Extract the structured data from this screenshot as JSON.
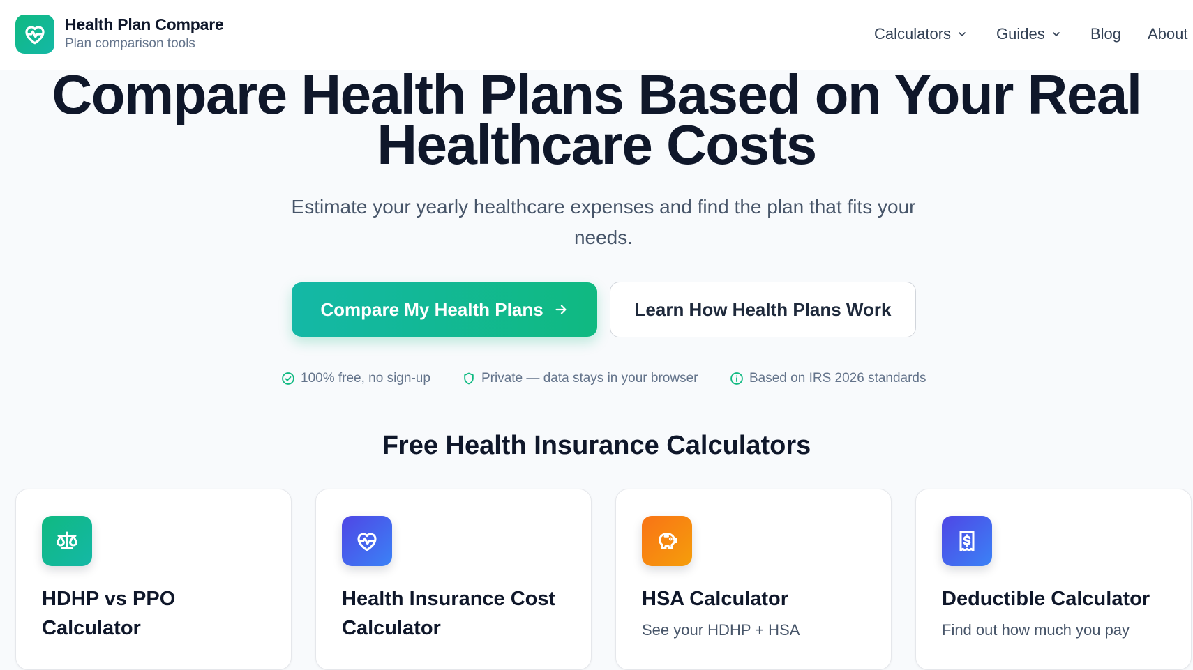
{
  "header": {
    "brand_title": "Health Plan Compare",
    "brand_subtitle": "Plan comparison tools",
    "nav": [
      {
        "label": "Calculators",
        "has_dropdown": true
      },
      {
        "label": "Guides",
        "has_dropdown": true
      },
      {
        "label": "Blog",
        "has_dropdown": false
      },
      {
        "label": "About",
        "has_dropdown": false
      }
    ]
  },
  "hero": {
    "title_line1": "Compare Health Plans Based on Your Real",
    "title_line2": "Healthcare Costs",
    "subtitle": "Estimate your yearly healthcare expenses and find the plan that fits your needs.",
    "primary_cta": "Compare My Health Plans",
    "secondary_cta": "Learn How Health Plans Work",
    "trust_badges": [
      {
        "icon": "check-circle-icon",
        "label": "100% free, no sign-up"
      },
      {
        "icon": "shield-icon",
        "label": "Private — data stays in your browser"
      },
      {
        "icon": "info-circle-icon",
        "label": "Based on IRS 2026 standards"
      }
    ]
  },
  "calculators": {
    "section_title": "Free Health Insurance Calculators",
    "cards": [
      {
        "title": "HDHP vs PPO Calculator",
        "description": "",
        "icon": "scale-icon",
        "color": "#10b981"
      },
      {
        "title": "Health Insurance Cost Calculator",
        "description": "",
        "icon": "heart-pulse-icon",
        "color": "#6366f1"
      },
      {
        "title": "HSA Calculator",
        "description": "See your HDHP + HSA",
        "icon": "piggy-bank-icon",
        "color": "#f97316"
      },
      {
        "title": "Deductible Calculator",
        "description": "Find out how much you pay",
        "icon": "receipt-dollar-icon",
        "color": "#4f46e5"
      }
    ]
  },
  "colors": {
    "brand": "#10b981",
    "text": "#0f172a",
    "muted": "#64748b",
    "background": "#f8fafc"
  }
}
